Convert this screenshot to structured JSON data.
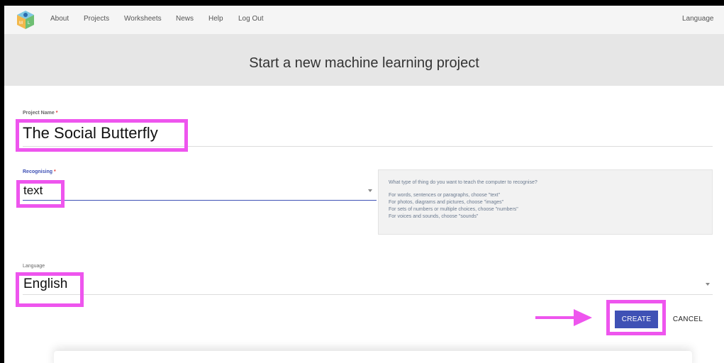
{
  "nav": {
    "links": [
      "About",
      "Projects",
      "Worksheets",
      "News",
      "Help",
      "Log Out"
    ],
    "language": "Language"
  },
  "header": {
    "title": "Start a new machine learning project"
  },
  "form": {
    "project_name": {
      "label": "Project Name",
      "required": "*",
      "value": "The Social Butterfly"
    },
    "recognising": {
      "label": "Recognising",
      "required": "*",
      "value": "text"
    },
    "language": {
      "label": "Language",
      "value": "English"
    },
    "help": {
      "question": "What type of thing do you want to teach the computer to recognise?",
      "lines": [
        "For words, sentences or paragraphs, choose \"text\"",
        "For photos, diagrams and pictures, choose \"images\"",
        "For sets of numbers or multiple choices, choose \"numbers\"",
        "For voices and sounds, choose \"sounds\""
      ]
    }
  },
  "actions": {
    "create": "CREATE",
    "cancel": "CANCEL"
  },
  "colors": {
    "accent": "#3f51b5",
    "highlight": "#ee55ee"
  },
  "icons": {
    "logo": "ml-cube-logo-icon",
    "caret": "chevron-down-icon",
    "arrow": "arrow-right-icon"
  }
}
